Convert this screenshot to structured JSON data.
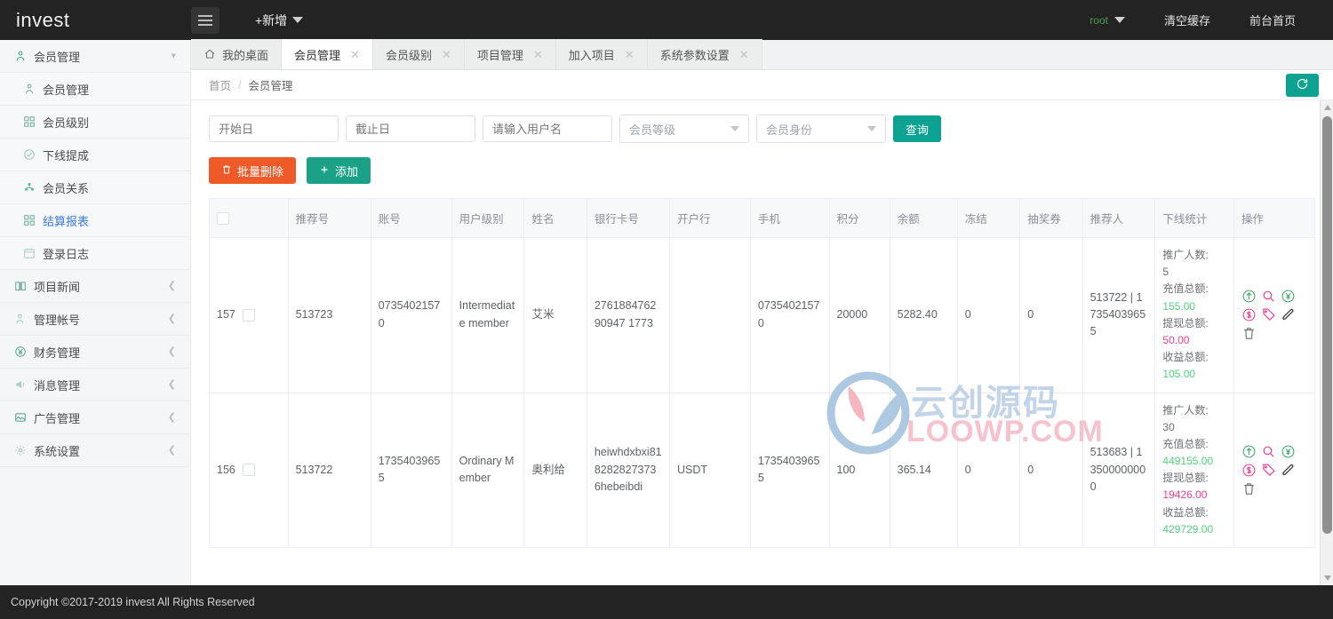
{
  "brand": "invest",
  "topbar": {
    "hamburger_icon": "menu-icon",
    "add_label": "+新增",
    "user": "root",
    "clear_cache": "清空缓存",
    "front_page": "前台首页"
  },
  "sidebar": {
    "items": [
      {
        "label": "会员管理",
        "icon": "user-icon",
        "level": "top",
        "chevron": "down",
        "active": false
      },
      {
        "label": "会员管理",
        "icon": "user-icon",
        "level": "sub",
        "chevron": "",
        "active": false
      },
      {
        "label": "会员级别",
        "icon": "grid-icon",
        "level": "sub",
        "chevron": "",
        "active": false
      },
      {
        "label": "下线提成",
        "icon": "check-circle-icon",
        "level": "sub",
        "chevron": "",
        "active": false
      },
      {
        "label": "会员关系",
        "icon": "tree-icon",
        "level": "sub",
        "chevron": "",
        "active": false
      },
      {
        "label": "结算报表",
        "icon": "grid-icon",
        "level": "sub",
        "chevron": "",
        "active": true
      },
      {
        "label": "登录日志",
        "icon": "calendar-icon",
        "level": "sub",
        "chevron": "",
        "active": false
      },
      {
        "label": "项目新闻",
        "icon": "book-icon",
        "level": "top",
        "chevron": "left",
        "active": false
      },
      {
        "label": "管理帐号",
        "icon": "users-icon",
        "level": "top",
        "chevron": "left",
        "active": false
      },
      {
        "label": "财务管理",
        "icon": "yen-icon",
        "level": "top",
        "chevron": "left",
        "active": false
      },
      {
        "label": "消息管理",
        "icon": "speaker-icon",
        "level": "top",
        "chevron": "left",
        "active": false
      },
      {
        "label": "广告管理",
        "icon": "image-icon",
        "level": "top",
        "chevron": "left",
        "active": false
      },
      {
        "label": "系统设置",
        "icon": "gear-icon",
        "level": "top",
        "chevron": "left",
        "active": false
      }
    ]
  },
  "tabs": [
    {
      "label": "我的桌面",
      "closable": false,
      "active": false,
      "home_icon": "home-icon"
    },
    {
      "label": "会员管理",
      "closable": true,
      "active": true
    },
    {
      "label": "会员级别",
      "closable": true,
      "active": false
    },
    {
      "label": "项目管理",
      "closable": true,
      "active": false
    },
    {
      "label": "加入项目",
      "closable": true,
      "active": false
    },
    {
      "label": "系统参数设置",
      "closable": true,
      "active": false
    }
  ],
  "breadcrumb": {
    "root": "首页",
    "sep": "/",
    "current": "会员管理"
  },
  "refresh_icon": "refresh-icon",
  "filters": {
    "start_date_placeholder": "开始日",
    "end_date_placeholder": "截止日",
    "username_placeholder": "请输入用户名",
    "level_select": "会员等级",
    "identity_select": "会员身份",
    "search_label": "查询"
  },
  "actions": {
    "batch_delete": "批量删除",
    "batch_delete_icon": "trash-icon",
    "add": "添加",
    "add_icon": "plus-icon"
  },
  "table": {
    "headers": [
      "",
      "推荐号",
      "账号",
      "用户级别",
      "姓名",
      "银行卡号",
      "开户行",
      "手机",
      "积分",
      "余额",
      "冻结",
      "抽奖券",
      "推荐人",
      "下线统计",
      "操作"
    ],
    "stat_labels": {
      "promo_count": "推广人数:",
      "recharge_total": "充值总额:",
      "withdraw_total": "提现总额:",
      "profit_total": "收益总额:"
    },
    "op_icons": [
      "arrow-up-circle-icon",
      "search-icon",
      "yen-circle-icon",
      "dollar-circle-icon",
      "tag-icon",
      "pencil-icon",
      "trash-icon"
    ],
    "rows": [
      {
        "id": "157",
        "referral_no": "513723",
        "account": "07354021570",
        "user_level": "Intermediate member",
        "name": "艾米",
        "bank_card": "276188476290947 1773",
        "bank": "",
        "phone": "07354021570",
        "points": "20000",
        "balance": "5282.40",
        "frozen": "0",
        "lottery": "0",
        "referrer": "513722 | 17354039655",
        "promo_count": "5",
        "recharge_total": "155.00",
        "withdraw_total": "50.00",
        "profit_total": "105.00"
      },
      {
        "id": "156",
        "referral_no": "513722",
        "account": "17354039655",
        "user_level": "Ordinary Member",
        "name": "奥利给",
        "bank_card": "heiwhdxbxi8182828273736hebeibdi",
        "bank": "USDT",
        "phone": "17354039655",
        "points": "100",
        "balance": "365.14",
        "frozen": "0",
        "lottery": "0",
        "referrer": "513683 | 13500000000",
        "promo_count": "30",
        "recharge_total": "449155.00",
        "withdraw_total": "19426.00",
        "profit_total": "429729.00"
      }
    ]
  },
  "watermark": {
    "cn": "云创源码",
    "en": "LOOWP.COM"
  },
  "footer": "Copyright ©2017-2019 invest All Rights Reserved",
  "colors": {
    "accent_green": "#0ba292",
    "danger_orange": "#f05a28",
    "active_blue": "#3a7bd5",
    "stat_green": "#52d17c",
    "stat_pink": "#ee3f8e",
    "topbar_dark": "#232323"
  }
}
